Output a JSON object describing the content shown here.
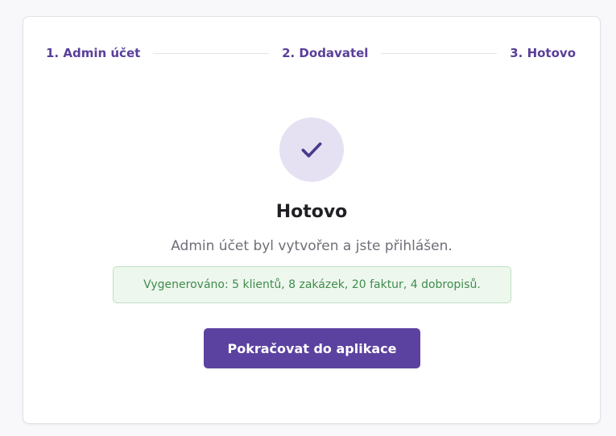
{
  "stepper": {
    "steps": [
      {
        "label": "1. Admin účet"
      },
      {
        "label": "2. Dodavatel"
      },
      {
        "label": "3. Hotovo"
      }
    ]
  },
  "result": {
    "icon": "check-icon",
    "title": "Hotovo",
    "subtitle": "Admin účet byl vytvořen a jste přihlášen.",
    "notice": "Vygenerováno: 5 klientů, 8 zakázek, 20 faktur, 4 dobropisů."
  },
  "actions": {
    "continue_label": "Pokračovat do aplikace"
  },
  "colors": {
    "accent": "#5b42a0",
    "success_text": "#3f8c4c",
    "success_bg": "#eef7ee"
  }
}
